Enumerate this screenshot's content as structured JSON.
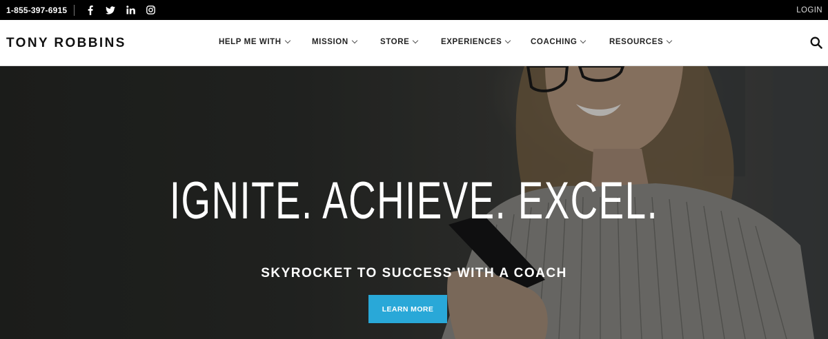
{
  "topbar": {
    "phone": "1-855-397-6915",
    "social": [
      "facebook-icon",
      "twitter-icon",
      "linkedin-icon",
      "instagram-icon"
    ],
    "login": "LOGIN"
  },
  "header": {
    "logo": "TONY ROBBINS",
    "nav": [
      {
        "label": "HELP ME WITH"
      },
      {
        "label": "MISSION"
      },
      {
        "label": "STORE"
      },
      {
        "label": "EXPERIENCES"
      },
      {
        "label": "COACHING"
      },
      {
        "label": "RESOURCES"
      }
    ],
    "search_icon": "search-icon"
  },
  "hero": {
    "headline": "IGNITE. ACHIEVE. EXCEL.",
    "subheadline": "SKYROCKET TO SUCCESS WITH A COACH",
    "cta": "LEARN MORE",
    "cta_color": "#29a8d8"
  }
}
